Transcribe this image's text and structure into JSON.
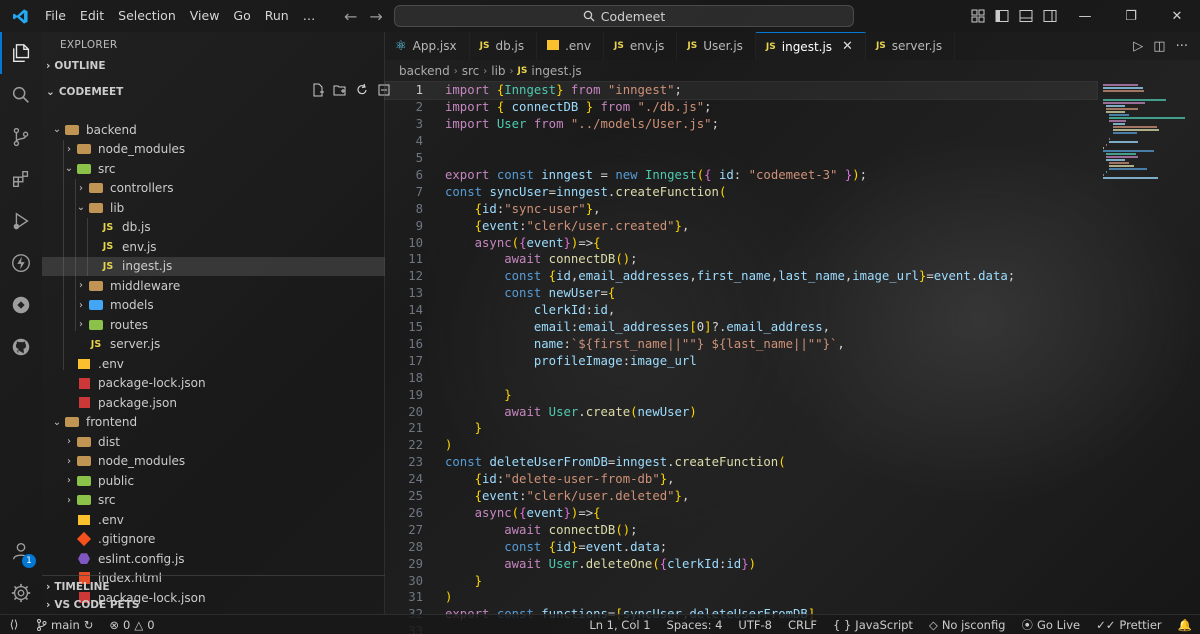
{
  "titlebar": {
    "menu": [
      "File",
      "Edit",
      "Selection",
      "View",
      "Go",
      "Run",
      "…"
    ],
    "search_text": "Codemeet",
    "accent": "#0078d4"
  },
  "sidebar": {
    "title": "EXPLORER",
    "outline_label": "OUTLINE",
    "project_label": "CODEMEET",
    "tree": [
      {
        "label": "backend",
        "kind": "folder",
        "depth": 0,
        "open": true
      },
      {
        "label": "node_modules",
        "kind": "folder",
        "depth": 1,
        "open": false
      },
      {
        "label": "src",
        "kind": "folder-green",
        "depth": 1,
        "open": true
      },
      {
        "label": "controllers",
        "kind": "folder",
        "depth": 2,
        "open": false
      },
      {
        "label": "lib",
        "kind": "folder",
        "depth": 2,
        "open": true
      },
      {
        "label": "db.js",
        "kind": "js",
        "depth": 3
      },
      {
        "label": "env.js",
        "kind": "js",
        "depth": 3
      },
      {
        "label": "ingest.js",
        "kind": "js",
        "depth": 3,
        "selected": true
      },
      {
        "label": "middleware",
        "kind": "folder",
        "depth": 2,
        "open": false
      },
      {
        "label": "models",
        "kind": "folder-blue",
        "depth": 2,
        "open": false
      },
      {
        "label": "routes",
        "kind": "folder-green",
        "depth": 2,
        "open": false
      },
      {
        "label": "server.js",
        "kind": "js",
        "depth": 2
      },
      {
        "label": ".env",
        "kind": "env",
        "depth": 1
      },
      {
        "label": "package-lock.json",
        "kind": "npm",
        "depth": 1
      },
      {
        "label": "package.json",
        "kind": "npm",
        "depth": 1
      },
      {
        "label": "frontend",
        "kind": "folder",
        "depth": 0,
        "open": true
      },
      {
        "label": "dist",
        "kind": "folder",
        "depth": 1,
        "open": false
      },
      {
        "label": "node_modules",
        "kind": "folder",
        "depth": 1,
        "open": false
      },
      {
        "label": "public",
        "kind": "folder-green",
        "depth": 1,
        "open": false
      },
      {
        "label": "src",
        "kind": "folder-green",
        "depth": 1,
        "open": false
      },
      {
        "label": ".env",
        "kind": "env",
        "depth": 1
      },
      {
        "label": ".gitignore",
        "kind": "git",
        "depth": 1
      },
      {
        "label": "eslint.config.js",
        "kind": "eslint",
        "depth": 1
      },
      {
        "label": "index.html",
        "kind": "html",
        "depth": 1
      },
      {
        "label": "package-lock.json",
        "kind": "npm",
        "depth": 1
      }
    ],
    "timeline_label": "TIMELINE",
    "vscode_pets_label": "VS CODE PETS"
  },
  "tabs": [
    {
      "label": "App.jsx",
      "icon": "react-icon"
    },
    {
      "label": "db.js",
      "icon": "js-icon"
    },
    {
      "label": ".env",
      "icon": "env-icon"
    },
    {
      "label": "env.js",
      "icon": "js-icon"
    },
    {
      "label": "User.js",
      "icon": "js-icon"
    },
    {
      "label": "ingest.js",
      "icon": "js-icon",
      "active": true
    },
    {
      "label": "server.js",
      "icon": "js-icon"
    }
  ],
  "breadcrumb": [
    "backend",
    "src",
    "lib",
    "ingest.js"
  ],
  "code": [
    "import {Inngest} from \"inngest\";",
    "import { connectDB } from \"./db.js\";",
    "import User from \"../models/User.js\";",
    "",
    "",
    "export const inngest = new Inngest({ id: \"codemeet-3\" });",
    "const syncUser=inngest.createFunction(",
    "    {id:\"sync-user\"},",
    "    {event:\"clerk/user.created\"},",
    "    async({event})=>{",
    "        await connectDB();",
    "        const {id,email_addresses,first_name,last_name,image_url}=event.data;",
    "        const newUser={",
    "            clerkId:id,",
    "            email:email_addresses[0]?.email_address,",
    "            name:`${first_name||\"\"} ${last_name||\"\"}`,",
    "            profileImage:image_url",
    "",
    "        }",
    "        await User.create(newUser)",
    "    }",
    ")",
    "const deleteUserFromDB=inngest.createFunction(",
    "    {id:\"delete-user-from-db\"},",
    "    {event:\"clerk/user.deleted\"},",
    "    async({event})=>{",
    "        await connectDB();",
    "        const {id}=event.data;",
    "        await User.deleteOne({clerkId:id})",
    "    }",
    ")",
    "export const functions=[syncUser,deleteUserFromDB]",
    ""
  ],
  "statusbar": {
    "branch": "main",
    "errors": "0",
    "warnings": "0",
    "position": "Ln 1, Col 1",
    "spaces": "Spaces: 4",
    "encoding": "UTF-8",
    "eol": "CRLF",
    "language": "JavaScript",
    "jsconfig": "No jsconfig",
    "golive": "Go Live",
    "prettier": "Prettier"
  },
  "accounts_badge": "1"
}
